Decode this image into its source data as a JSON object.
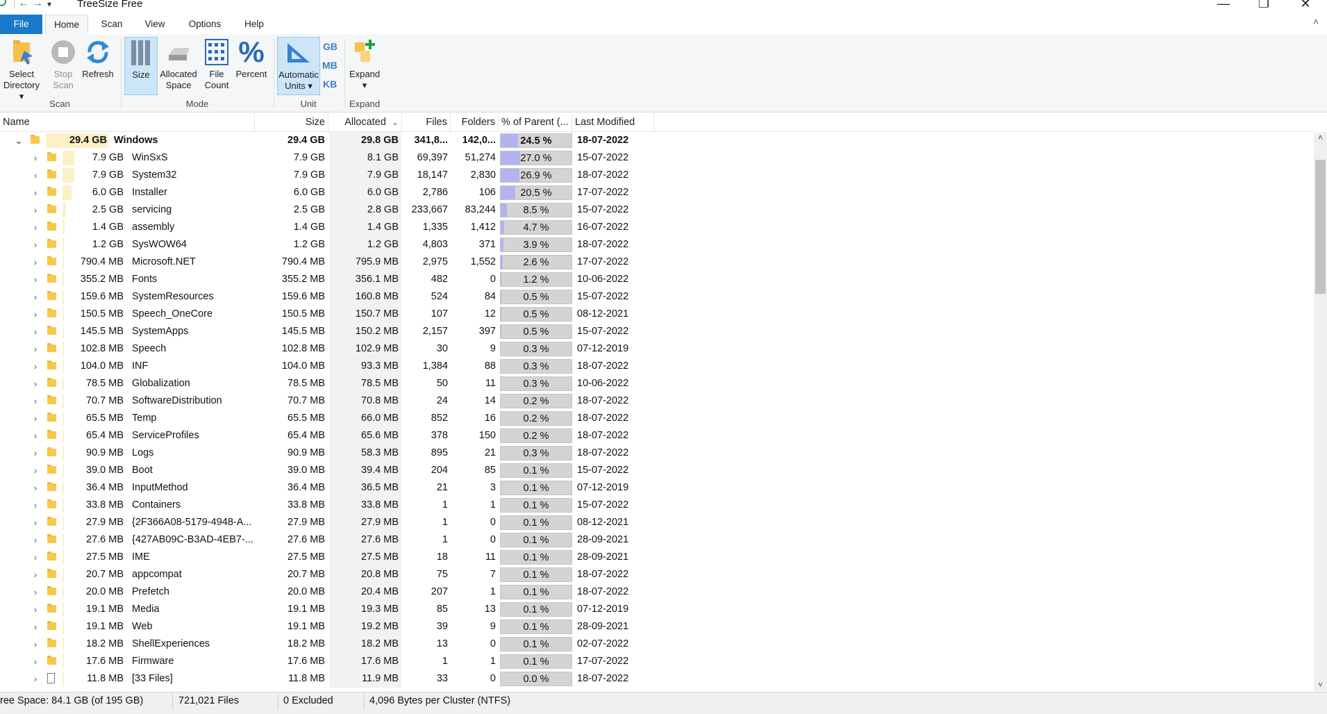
{
  "window": {
    "title": "TreeSize Free",
    "minimize": "—",
    "restore": "❐",
    "close": "✕",
    "back": "←",
    "forward": "→",
    "dropdown": "▾"
  },
  "tabs": [
    "File",
    "Home",
    "Scan",
    "View",
    "Options",
    "Help"
  ],
  "ribbon": {
    "scan_group": "Scan",
    "mode_group": "Mode",
    "unit_group": "Unit",
    "expand_group": "Expand",
    "select_directory": [
      "Select",
      "Directory ▾"
    ],
    "stop_scan": [
      "Stop",
      "Scan"
    ],
    "refresh": "Refresh",
    "size": "Size",
    "allocated_space": [
      "Allocated",
      "Space"
    ],
    "file_count": [
      "File",
      "Count"
    ],
    "percent": "Percent",
    "automatic_units": [
      "Automatic",
      "Units ▾"
    ],
    "unit_gb": "GB",
    "unit_mb": "MB",
    "unit_kb": "KB",
    "expand": "Expand",
    "expand_arrow": "▾",
    "collapse_ribbon": "˄"
  },
  "columns": {
    "name": "Name",
    "size": "Size",
    "allocated": "Allocated",
    "allocated_sort": "⌄",
    "files": "Files",
    "folders": "Folders",
    "pct_parent": "% of Parent (...",
    "last_modified": "Last Modified"
  },
  "root": {
    "expander": "⌄",
    "size_label": "29.4 GB",
    "name": "Windows",
    "size": "29.4 GB",
    "allocated": "29.8 GB",
    "files": "341,8...",
    "folders": "142,0...",
    "pct": "24.5 %",
    "pct_value": 24.5,
    "modified": "18-07-2022"
  },
  "rows": [
    {
      "size_label": "7.9 GB",
      "name": "WinSxS",
      "size": "7.9 GB",
      "allocated": "8.1 GB",
      "files": "69,397",
      "folders": "51,274",
      "pct": "27.0 %",
      "pct_value": 27.0,
      "modified": "15-07-2022",
      "type": "folder"
    },
    {
      "size_label": "7.9 GB",
      "name": "System32",
      "size": "7.9 GB",
      "allocated": "7.9 GB",
      "files": "18,147",
      "folders": "2,830",
      "pct": "26.9 %",
      "pct_value": 26.9,
      "modified": "18-07-2022",
      "type": "folder"
    },
    {
      "size_label": "6.0 GB",
      "name": "Installer",
      "size": "6.0 GB",
      "allocated": "6.0 GB",
      "files": "2,786",
      "folders": "106",
      "pct": "20.5 %",
      "pct_value": 20.5,
      "modified": "17-07-2022",
      "type": "folder"
    },
    {
      "size_label": "2.5 GB",
      "name": "servicing",
      "size": "2.5 GB",
      "allocated": "2.8 GB",
      "files": "233,667",
      "folders": "83,244",
      "pct": "8.5 %",
      "pct_value": 8.5,
      "modified": "15-07-2022",
      "type": "folder"
    },
    {
      "size_label": "1.4 GB",
      "name": "assembly",
      "size": "1.4 GB",
      "allocated": "1.4 GB",
      "files": "1,335",
      "folders": "1,412",
      "pct": "4.7 %",
      "pct_value": 4.7,
      "modified": "16-07-2022",
      "type": "folder"
    },
    {
      "size_label": "1.2 GB",
      "name": "SysWOW64",
      "size": "1.2 GB",
      "allocated": "1.2 GB",
      "files": "4,803",
      "folders": "371",
      "pct": "3.9 %",
      "pct_value": 3.9,
      "modified": "18-07-2022",
      "type": "folder"
    },
    {
      "size_label": "790.4 MB",
      "name": "Microsoft.NET",
      "size": "790.4 MB",
      "allocated": "795.9 MB",
      "files": "2,975",
      "folders": "1,552",
      "pct": "2.6 %",
      "pct_value": 2.6,
      "modified": "17-07-2022",
      "type": "folder"
    },
    {
      "size_label": "355.2 MB",
      "name": "Fonts",
      "size": "355.2 MB",
      "allocated": "356.1 MB",
      "files": "482",
      "folders": "0",
      "pct": "1.2 %",
      "pct_value": 1.2,
      "modified": "10-06-2022",
      "type": "folder"
    },
    {
      "size_label": "159.6 MB",
      "name": "SystemResources",
      "size": "159.6 MB",
      "allocated": "160.8 MB",
      "files": "524",
      "folders": "84",
      "pct": "0.5 %",
      "pct_value": 0.5,
      "modified": "15-07-2022",
      "type": "folder"
    },
    {
      "size_label": "150.5 MB",
      "name": "Speech_OneCore",
      "size": "150.5 MB",
      "allocated": "150.7 MB",
      "files": "107",
      "folders": "12",
      "pct": "0.5 %",
      "pct_value": 0.5,
      "modified": "08-12-2021",
      "type": "folder"
    },
    {
      "size_label": "145.5 MB",
      "name": "SystemApps",
      "size": "145.5 MB",
      "allocated": "150.2 MB",
      "files": "2,157",
      "folders": "397",
      "pct": "0.5 %",
      "pct_value": 0.5,
      "modified": "15-07-2022",
      "type": "folder"
    },
    {
      "size_label": "102.8 MB",
      "name": "Speech",
      "size": "102.8 MB",
      "allocated": "102.9 MB",
      "files": "30",
      "folders": "9",
      "pct": "0.3 %",
      "pct_value": 0.3,
      "modified": "07-12-2019",
      "type": "folder"
    },
    {
      "size_label": "104.0 MB",
      "name": "INF",
      "size": "104.0 MB",
      "allocated": "93.3 MB",
      "files": "1,384",
      "folders": "88",
      "pct": "0.3 %",
      "pct_value": 0.3,
      "modified": "18-07-2022",
      "type": "folder"
    },
    {
      "size_label": "78.5 MB",
      "name": "Globalization",
      "size": "78.5 MB",
      "allocated": "78.5 MB",
      "files": "50",
      "folders": "11",
      "pct": "0.3 %",
      "pct_value": 0.3,
      "modified": "10-06-2022",
      "type": "folder"
    },
    {
      "size_label": "70.7 MB",
      "name": "SoftwareDistribution",
      "size": "70.7 MB",
      "allocated": "70.8 MB",
      "files": "24",
      "folders": "14",
      "pct": "0.2 %",
      "pct_value": 0.2,
      "modified": "18-07-2022",
      "type": "folder"
    },
    {
      "size_label": "65.5 MB",
      "name": "Temp",
      "size": "65.5 MB",
      "allocated": "66.0 MB",
      "files": "852",
      "folders": "16",
      "pct": "0.2 %",
      "pct_value": 0.2,
      "modified": "18-07-2022",
      "type": "folder"
    },
    {
      "size_label": "65.4 MB",
      "name": "ServiceProfiles",
      "size": "65.4 MB",
      "allocated": "65.6 MB",
      "files": "378",
      "folders": "150",
      "pct": "0.2 %",
      "pct_value": 0.2,
      "modified": "18-07-2022",
      "type": "folder"
    },
    {
      "size_label": "90.9 MB",
      "name": "Logs",
      "size": "90.9 MB",
      "allocated": "58.3 MB",
      "files": "895",
      "folders": "21",
      "pct": "0.3 %",
      "pct_value": 0.3,
      "modified": "18-07-2022",
      "type": "folder"
    },
    {
      "size_label": "39.0 MB",
      "name": "Boot",
      "size": "39.0 MB",
      "allocated": "39.4 MB",
      "files": "204",
      "folders": "85",
      "pct": "0.1 %",
      "pct_value": 0.1,
      "modified": "15-07-2022",
      "type": "folder"
    },
    {
      "size_label": "36.4 MB",
      "name": "InputMethod",
      "size": "36.4 MB",
      "allocated": "36.5 MB",
      "files": "21",
      "folders": "3",
      "pct": "0.1 %",
      "pct_value": 0.1,
      "modified": "07-12-2019",
      "type": "folder"
    },
    {
      "size_label": "33.8 MB",
      "name": "Containers",
      "size": "33.8 MB",
      "allocated": "33.8 MB",
      "files": "1",
      "folders": "1",
      "pct": "0.1 %",
      "pct_value": 0.1,
      "modified": "15-07-2022",
      "type": "folder"
    },
    {
      "size_label": "27.9 MB",
      "name": "{2F366A08-5179-4948-A...",
      "size": "27.9 MB",
      "allocated": "27.9 MB",
      "files": "1",
      "folders": "0",
      "pct": "0.1 %",
      "pct_value": 0.1,
      "modified": "08-12-2021",
      "type": "folder"
    },
    {
      "size_label": "27.6 MB",
      "name": "{427AB09C-B3AD-4EB7-...",
      "size": "27.6 MB",
      "allocated": "27.6 MB",
      "files": "1",
      "folders": "0",
      "pct": "0.1 %",
      "pct_value": 0.1,
      "modified": "28-09-2021",
      "type": "folder"
    },
    {
      "size_label": "27.5 MB",
      "name": "IME",
      "size": "27.5 MB",
      "allocated": "27.5 MB",
      "files": "18",
      "folders": "11",
      "pct": "0.1 %",
      "pct_value": 0.1,
      "modified": "28-09-2021",
      "type": "folder"
    },
    {
      "size_label": "20.7 MB",
      "name": "appcompat",
      "size": "20.7 MB",
      "allocated": "20.8 MB",
      "files": "75",
      "folders": "7",
      "pct": "0.1 %",
      "pct_value": 0.1,
      "modified": "18-07-2022",
      "type": "folder"
    },
    {
      "size_label": "20.0 MB",
      "name": "Prefetch",
      "size": "20.0 MB",
      "allocated": "20.4 MB",
      "files": "207",
      "folders": "1",
      "pct": "0.1 %",
      "pct_value": 0.1,
      "modified": "18-07-2022",
      "type": "folder"
    },
    {
      "size_label": "19.1 MB",
      "name": "Media",
      "size": "19.1 MB",
      "allocated": "19.3 MB",
      "files": "85",
      "folders": "13",
      "pct": "0.1 %",
      "pct_value": 0.1,
      "modified": "07-12-2019",
      "type": "folder"
    },
    {
      "size_label": "19.1 MB",
      "name": "Web",
      "size": "19.1 MB",
      "allocated": "19.2 MB",
      "files": "39",
      "folders": "9",
      "pct": "0.1 %",
      "pct_value": 0.1,
      "modified": "28-09-2021",
      "type": "folder"
    },
    {
      "size_label": "18.2 MB",
      "name": "ShellExperiences",
      "size": "18.2 MB",
      "allocated": "18.2 MB",
      "files": "13",
      "folders": "0",
      "pct": "0.1 %",
      "pct_value": 0.1,
      "modified": "02-07-2022",
      "type": "folder"
    },
    {
      "size_label": "17.6 MB",
      "name": "Firmware",
      "size": "17.6 MB",
      "allocated": "17.6 MB",
      "files": "1",
      "folders": "1",
      "pct": "0.1 %",
      "pct_value": 0.1,
      "modified": "17-07-2022",
      "type": "folder"
    },
    {
      "size_label": "11.8 MB",
      "name": "[33 Files]",
      "size": "11.8 MB",
      "allocated": "11.9 MB",
      "files": "33",
      "folders": "0",
      "pct": "0.0 %",
      "pct_value": 0.0,
      "modified": "18-07-2022",
      "type": "file"
    }
  ],
  "row_expander": "›",
  "scrollbar": {
    "up": "˄",
    "down": "˅",
    "thumb_start_fraction": 0.03,
    "thumb_size_fraction": 0.25
  },
  "status": {
    "free_space": "ree Space: 84.1 GB  (of 195 GB)",
    "files": "721,021 Files",
    "excluded": "0 Excluded",
    "cluster": "4,096 Bytes per Cluster (NTFS)"
  },
  "colors": {
    "file_tab": "#1979ca",
    "size_bar": "#fdf0c4",
    "percent_bar": "#b3b3f2",
    "folder": "#f8c84a",
    "accent_blue": "#3a7fd0"
  }
}
